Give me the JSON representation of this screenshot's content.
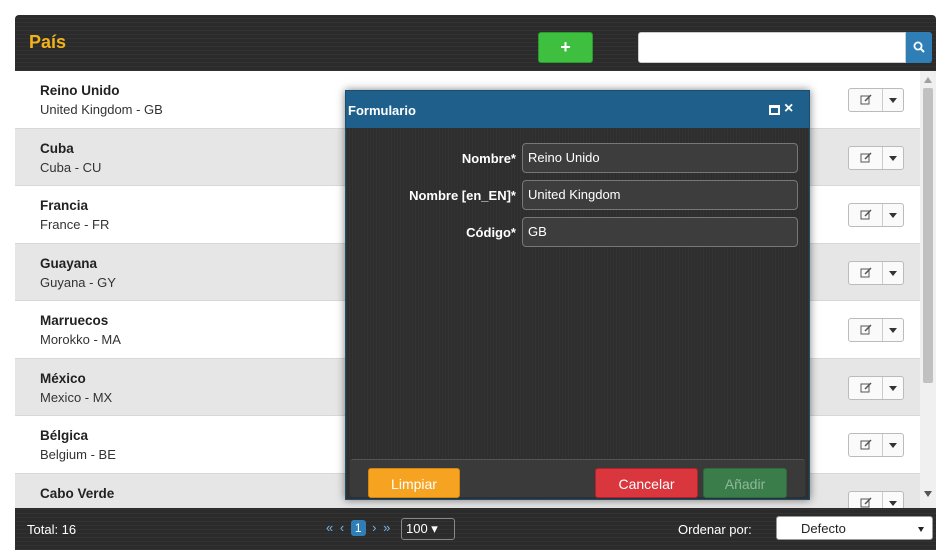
{
  "header": {
    "title": "País",
    "add_label": "+",
    "search_placeholder": ""
  },
  "rows": [
    {
      "name": "Reino Unido",
      "sub": "United Kingdom - GB"
    },
    {
      "name": "Cuba",
      "sub": "Cuba - CU"
    },
    {
      "name": "Francia",
      "sub": "France - FR"
    },
    {
      "name": "Guayana",
      "sub": "Guyana - GY"
    },
    {
      "name": "Marruecos",
      "sub": "Morokko - MA"
    },
    {
      "name": "México",
      "sub": "Mexico - MX"
    },
    {
      "name": "Bélgica",
      "sub": "Belgium - BE"
    },
    {
      "name": "Cabo Verde",
      "sub": ""
    }
  ],
  "footer": {
    "total": "Total: 16",
    "first": "«",
    "prev": "‹",
    "current_page": "1",
    "next": "›",
    "last": "»",
    "per_page": "100 ▾",
    "sort_label": "Ordenar por:",
    "sort_value": "Defecto"
  },
  "modal": {
    "title": "Formulario",
    "close": "×",
    "fields": [
      {
        "label": "Nombre*",
        "value": "Reino Unido"
      },
      {
        "label": "Nombre [en_EN]*",
        "value": "United Kingdom"
      },
      {
        "label": "Código*",
        "value": "GB"
      }
    ],
    "buttons": {
      "clear": "Limpiar",
      "cancel": "Cancelar",
      "add": "Añadir"
    }
  },
  "colors": {
    "accent_title": "#f2b21c",
    "primary": "#2f7fb6",
    "success": "#3fbf3f",
    "warning": "#f6a321",
    "danger": "#d9363e"
  },
  "icons": [
    "plus-icon",
    "search-icon",
    "edit-icon",
    "caret-down-icon",
    "maximize-icon",
    "close-icon"
  ]
}
